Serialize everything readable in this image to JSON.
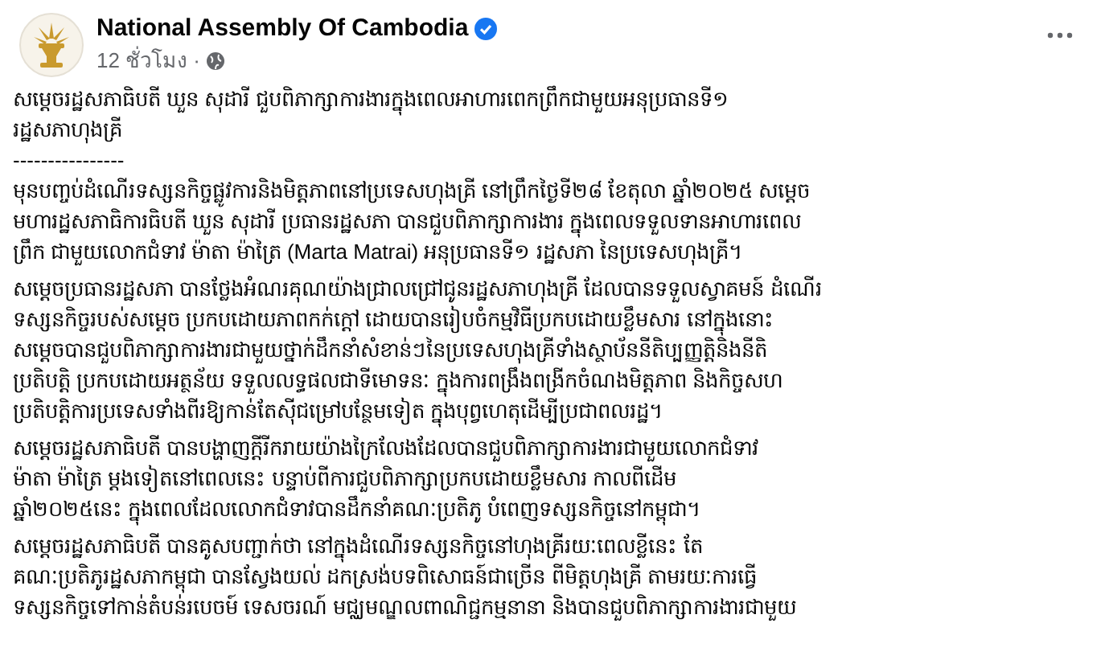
{
  "header": {
    "page_name": "National Assembly Of Cambodia",
    "verified": true,
    "time": "12 ชั่วโมง",
    "separator": "·"
  },
  "title_lines": [
    "សម្តេចរដ្ឋសភាធិបតី ឃួន សុដារី ជួបពិភាក្សាការងារក្នុងពេលអាហារពេកព្រឹកជាមួយអនុប្រធានទី១",
    "រដ្ឋសភាហុងគ្រី"
  ],
  "divider": "----------------",
  "paragraphs": [
    {
      "lines": [
        "មុនបញ្ចប់ដំណើរទស្សនកិច្ចផ្លូវការនិងមិត្តភាពនៅប្រទេសហុងគ្រី នៅព្រឹកថ្ងៃទី២៨ ខែតុលា ឆ្នាំ២០២៥ សម្តេច",
        "មហារដ្ឋសភាធិការធិបតី ឃួន សុដារី ប្រធានរដ្ឋសភា បានជួបពិភាក្សាការងារ ក្នុងពេលទទួលទានអាហារពេល",
        "ព្រឹក ជាមួយលោកជំទាវ  ម៉ាតា ម៉ាត្រៃ (Marta Matrai) អនុប្រធានទី១ រដ្ឋសភា នៃប្រទេសហុងគ្រី។"
      ]
    },
    {
      "lines": [
        "សម្តេចប្រធានរដ្ឋសភា បានថ្លែងអំណរគុណយ៉ាងជ្រាលជ្រៅជូនរដ្ឋសភាហុងគ្រី ដែលបានទទួលស្វាគមន៍ ដំណើរ",
        "ទស្សនកិច្ចរបស់សម្តេច ប្រកបដោយភាពកក់ក្តៅ ដោយបានរៀបចំកម្មវិធីប្រកបដោយខ្លឹមសារ នៅក្នុងនោះ",
        "សម្តេចបានជួបពិភាក្សាការងារជាមួយថ្នាក់ដឹកនាំសំខាន់ៗនៃប្រទេសហុងគ្រីទាំងស្ថាប័ននីតិប្បញ្ញត្តិនិងនីតិ",
        "ប្រតិបត្តិ ប្រកបដោយអត្ថន័យ ទទួលលទ្ធផលជាទីមោទនៈ ក្នុងការពង្រឹងពង្រីកចំណងមិត្តភាព និងកិច្ចសហ",
        "ប្រតិបត្តិការប្រទេសទាំងពីរឱ្យកាន់តែស៊ីជម្រៅបន្ថែមទៀត ក្នុងបុព្វហេតុដើម្បីប្រជាពលរដ្ឋ។"
      ]
    },
    {
      "lines": [
        "សម្តេចរដ្ឋសភាធិបតី បានបង្ហាញក្តីរីករាយយ៉ាងក្រៃលែងដែលបានជួបពិភាក្សាការងារជាមួយលោកជំទាវ",
        "ម៉ាតា ម៉ាត្រៃ ម្តងទៀតនៅពេលនេះ បន្ទាប់ពីការជួបពិភាក្សាប្រកបដោយខ្លឹមសារ កាលពីដើម",
        "ឆ្នាំ២០២៥នេះ ក្នុងពេលដែលលោកជំទាវបានដឹកនាំគណៈប្រតិភូ បំពេញទស្សនកិច្ចនៅកម្ពុជា។"
      ]
    },
    {
      "lines": [
        "សម្តេចរដ្ឋសភាធិបតី បានគូសបញ្ជាក់ថា នៅក្នុងដំណើរទស្សនកិច្ចនៅហុងគ្រីរយៈពេលខ្លីនេះ តែ",
        "គណៈប្រតិភូរដ្ឋសភាកម្ពុជា បានស្វែងយល់ ដកស្រង់បទពិសោធន៍ជាច្រើន ពីមិត្តហុងគ្រី តាមរយៈការធ្វើ",
        "ទស្សនកិច្ចទៅកាន់តំបន់របេចម៍ ទេសចរណ៍ មជ្ឈមណ្ឌលពាណិជ្ជកម្មនានា និងបានជួបពិភាក្សាការងារជាមួយ"
      ]
    }
  ]
}
